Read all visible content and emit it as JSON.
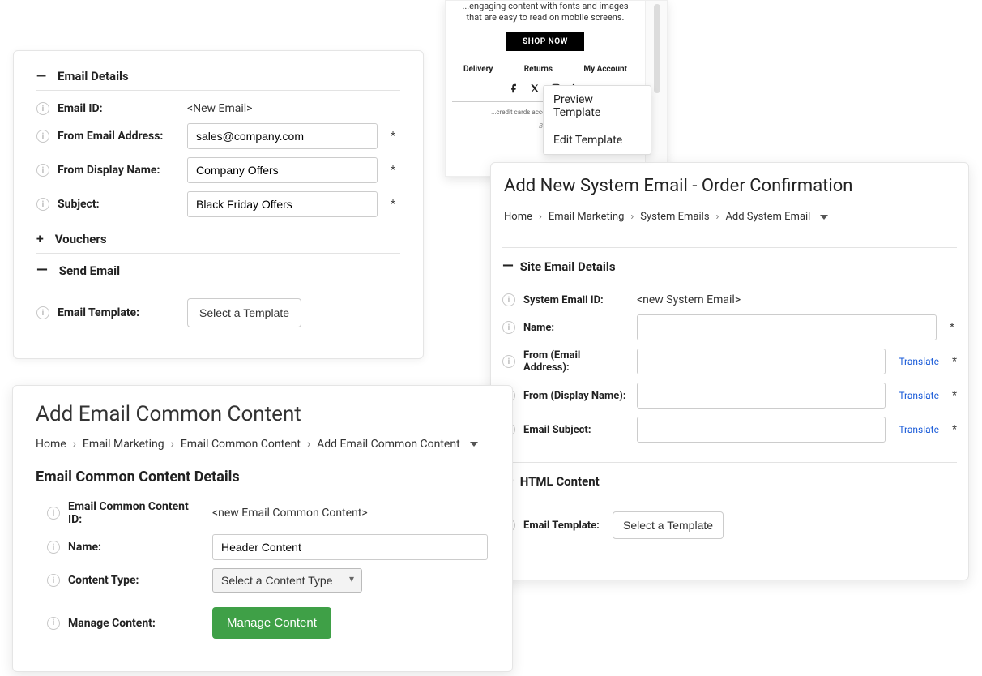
{
  "card1": {
    "section_email_details": "Email Details",
    "section_vouchers": "Vouchers",
    "section_send_email": "Send Email",
    "rows": {
      "email_id_label": "Email ID:",
      "email_id_value": "<New Email>",
      "from_email_label": "From Email Address:",
      "from_email_value": "sales@company.com",
      "from_display_label": "From Display Name:",
      "from_display_value": "Company Offers",
      "subject_label": "Subject:",
      "subject_value": "Black Friday Offers",
      "email_template_label": "Email Template:"
    },
    "select_template_btn": "Select a Template"
  },
  "card2": {
    "heading": "Add Email Common Content",
    "breadcrumb": {
      "home": "Home",
      "marketing": "Email Marketing",
      "common": "Email Common Content",
      "add": "Add Email Common Content"
    },
    "sub_title": "Email Common Content Details",
    "rows": {
      "id_label": "Email Common Content ID:",
      "id_value": "<new Email Common Content>",
      "name_label": "Name:",
      "name_value": "Header Content",
      "type_label": "Content Type:",
      "type_placeholder": "Select a Content Type",
      "manage_label": "Manage Content:"
    },
    "manage_btn": "Manage Content"
  },
  "template_preview": {
    "snippet_line": "...engaging content with fonts and images that are easy to read on mobile screens.",
    "shop_now": "SHOP NOW",
    "links": {
      "delivery": "Delivery",
      "returns": "Returns",
      "account": "My Account"
    },
    "fineprint": "...credit cards accepted | Fast check...",
    "beta": "Beta",
    "menu": {
      "preview": "Preview Template",
      "edit": "Edit Template"
    }
  },
  "card3": {
    "heading": "Add New System Email - Order Confirmation",
    "breadcrumb": {
      "home": "Home",
      "marketing": "Email Marketing",
      "system": "System Emails",
      "add": "Add System Email"
    },
    "section_site_details": "Site Email Details",
    "section_html_content": "HTML Content",
    "rows": {
      "sys_id_label": "System Email ID:",
      "sys_id_value": "<new System Email>",
      "name_label": "Name:",
      "from_email_label": "From (Email Address):",
      "from_display_label": "From (Display Name):",
      "subject_label": "Email Subject:",
      "email_template_label": "Email Template:"
    },
    "translate": "Translate",
    "select_template_btn": "Select a Template"
  },
  "symbols": {
    "asterisk": "*"
  }
}
